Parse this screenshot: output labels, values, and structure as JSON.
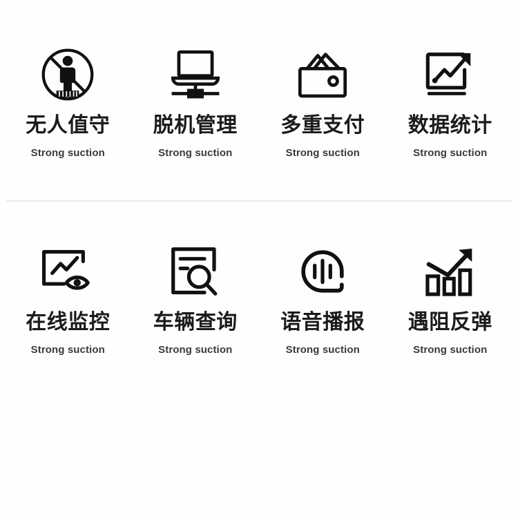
{
  "page": {
    "background_color": "#fefefe",
    "text_color": "#1b1b1b",
    "subtitle_color": "#3a3a3a",
    "divider_color": "#e8e8e8",
    "icon_color": "#111111"
  },
  "features": {
    "rows": [
      {
        "cells": [
          {
            "icon": "no-person-unattended-icon",
            "title": "无人值守",
            "subtitle": "Strong suction"
          },
          {
            "icon": "laptop-offline-network-icon",
            "title": "脱机管理",
            "subtitle": "Strong suction"
          },
          {
            "icon": "wallet-payment-icon",
            "title": "多重支付",
            "subtitle": "Strong suction"
          },
          {
            "icon": "trend-chart-screen-icon",
            "title": "数据统计",
            "subtitle": "Strong suction"
          }
        ]
      },
      {
        "cells": [
          {
            "icon": "chart-eye-monitor-icon",
            "title": "在线监控",
            "subtitle": "Strong suction"
          },
          {
            "icon": "document-search-icon",
            "title": "车辆查询",
            "subtitle": "Strong suction"
          },
          {
            "icon": "voice-broadcast-bubble-icon",
            "title": "语音播报",
            "subtitle": "Strong suction"
          },
          {
            "icon": "bar-chart-rebound-arrow-icon",
            "title": "遇阻反弹",
            "subtitle": "Strong suction"
          }
        ]
      }
    ]
  }
}
